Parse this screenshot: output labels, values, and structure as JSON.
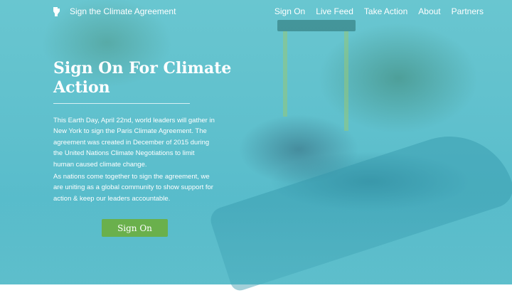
{
  "header": {
    "brand_title": "Sign the Climate Agreement",
    "logo_icon": "raised-fist-icon",
    "nav": [
      {
        "label": "Sign On"
      },
      {
        "label": "Live Feed"
      },
      {
        "label": "Take Action"
      },
      {
        "label": "About"
      },
      {
        "label": "Partners"
      }
    ]
  },
  "hero": {
    "headline": "Sign On For Climate Action",
    "paragraph_1": "This Earth Day, April 22nd, world leaders will gather in New York to sign the Paris Climate Agreement. The agreement was created in December of 2015 during the United Nations Climate Negotiations to limit human caused climate change.",
    "paragraph_2": "As nations come together to sign the agreement, we are uniting as a global community to show support for action & keep our leaders accountable.",
    "cta_label": "Sign On"
  },
  "colors": {
    "overlay_teal": "#5fc0cd",
    "cta_green": "#6ab04c",
    "text": "#ffffff"
  }
}
